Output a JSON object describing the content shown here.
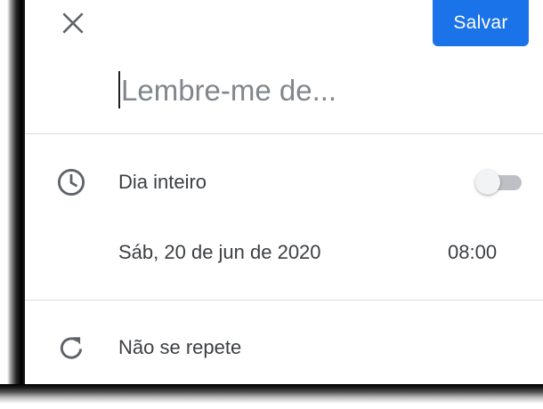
{
  "header": {
    "close_icon": "close-icon",
    "save_label": "Salvar"
  },
  "title_field": {
    "placeholder": "Lembre-me de...",
    "value": ""
  },
  "all_day": {
    "icon": "clock-icon",
    "label": "Dia inteiro",
    "enabled": false
  },
  "schedule": {
    "date": "Sáb, 20 de jun de 2020",
    "time": "08:00"
  },
  "repeat": {
    "icon": "repeat-icon",
    "label": "Não se repete"
  },
  "colors": {
    "accent": "#1a73e8",
    "text": "#3c4043",
    "icon": "#5f6368",
    "divider": "#dadce0",
    "toggle_track": "#bdc1c6",
    "toggle_thumb": "#f1f3f4"
  }
}
